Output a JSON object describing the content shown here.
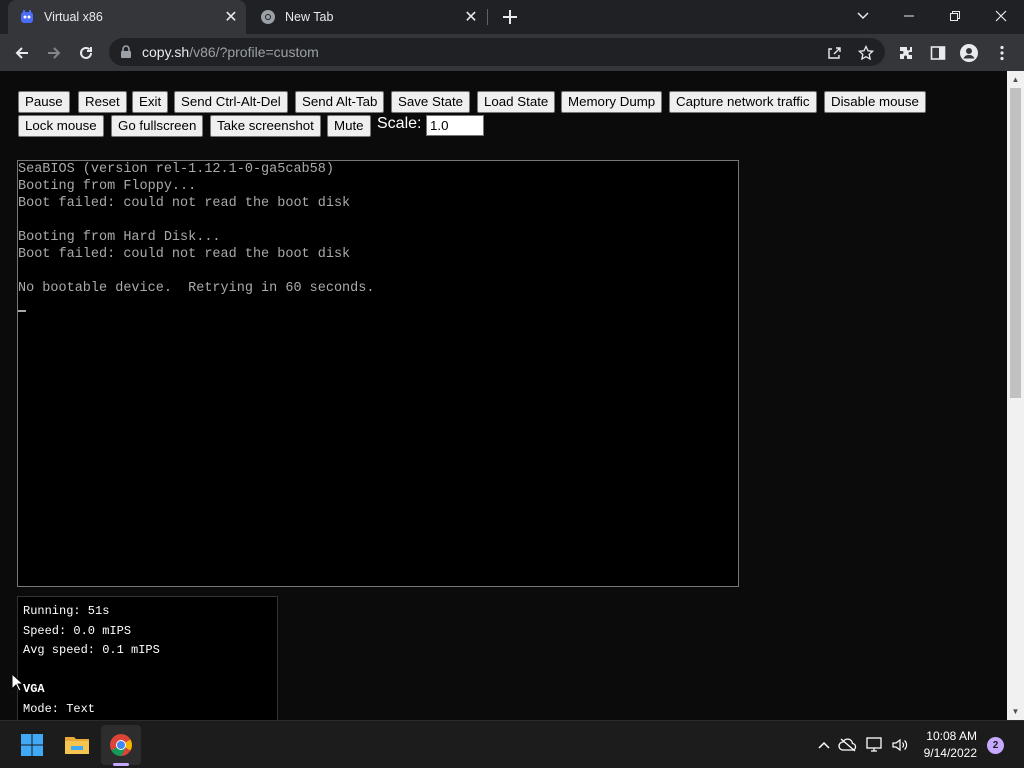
{
  "browser": {
    "tabs": [
      {
        "title": "Virtual x86",
        "active": true
      },
      {
        "title": "New Tab",
        "active": false
      }
    ],
    "url_host": "copy.sh",
    "url_path": "/v86/?profile=custom"
  },
  "controls": {
    "buttons": [
      "Pause",
      "Reset",
      "Exit",
      "Send Ctrl-Alt-Del",
      "Send Alt-Tab",
      "Save State",
      "Load State",
      "Memory Dump",
      "Capture network traffic",
      "Disable mouse",
      "Lock mouse",
      "Go fullscreen",
      "Take screenshot",
      "Mute"
    ],
    "scale_label": "Scale:",
    "scale_value": "1.0"
  },
  "terminal": {
    "lines": [
      "SeaBIOS (version rel-1.12.1-0-ga5cab58)",
      "Booting from Floppy...",
      "Boot failed: could not read the boot disk",
      "",
      "Booting from Hard Disk...",
      "Boot failed: could not read the boot disk",
      "",
      "No bootable device.  Retrying in 60 seconds."
    ]
  },
  "info": {
    "running": "Running: 51s",
    "speed": "Speed: 0.0 mIPS",
    "avg_speed": "Avg speed: 0.1 mIPS",
    "vga_heading": "VGA",
    "mode": "Mode: Text"
  },
  "taskbar": {
    "time": "10:08 AM",
    "date": "9/14/2022",
    "notification_count": "2"
  },
  "colors": {
    "chrome_dark": "#202124",
    "chrome_toolbar": "#35363a",
    "page_bg": "#0b0b0b",
    "terminal_text": "#aaaaaa",
    "taskbar_accent": "#c6a8ff"
  }
}
